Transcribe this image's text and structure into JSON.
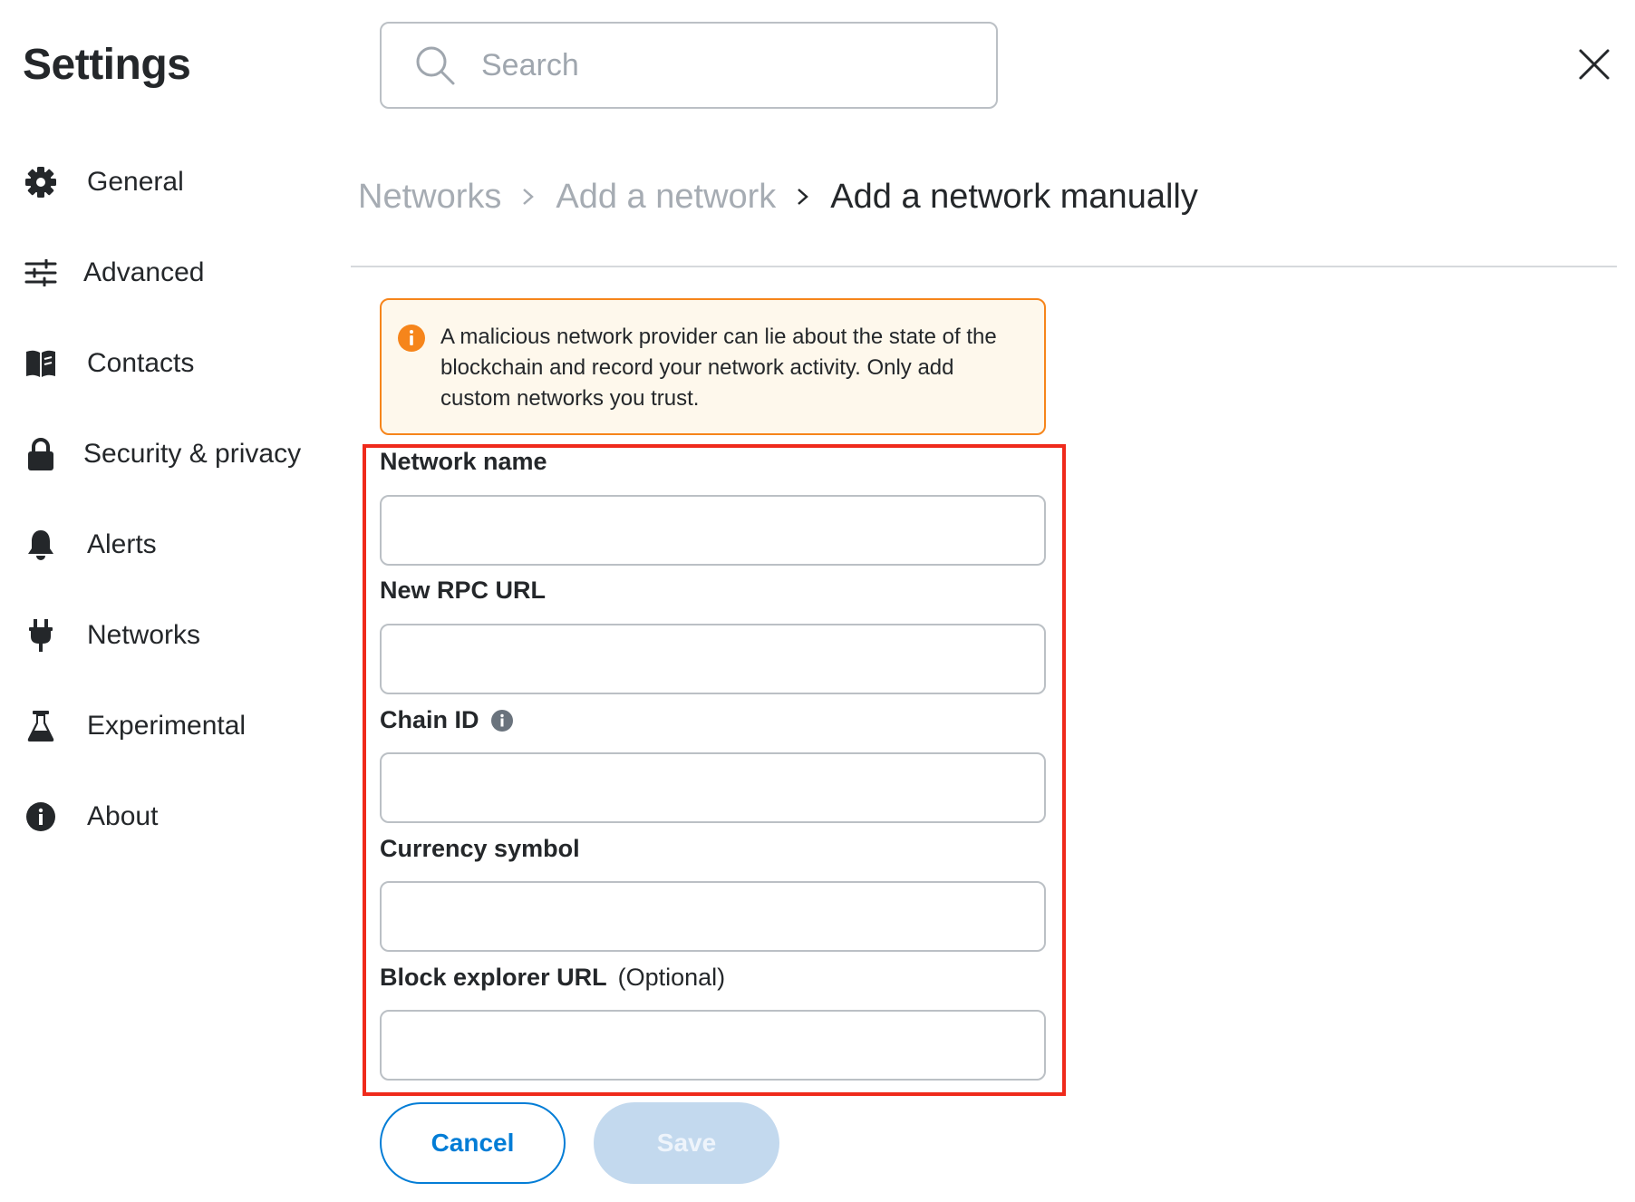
{
  "app": {
    "title": "Settings"
  },
  "search": {
    "placeholder": "Search"
  },
  "sidebar": {
    "items": [
      {
        "label": "General",
        "icon": "gear-icon"
      },
      {
        "label": "Advanced",
        "icon": "sliders-icon"
      },
      {
        "label": "Contacts",
        "icon": "book-icon"
      },
      {
        "label": "Security & privacy",
        "icon": "lock-icon"
      },
      {
        "label": "Alerts",
        "icon": "bell-icon"
      },
      {
        "label": "Networks",
        "icon": "plug-icon"
      },
      {
        "label": "Experimental",
        "icon": "flask-icon"
      },
      {
        "label": "About",
        "icon": "info-icon"
      }
    ]
  },
  "breadcrumb": {
    "items": [
      "Networks",
      "Add a network"
    ],
    "current": "Add a network manually"
  },
  "warning": {
    "text": "A malicious network provider can lie about the state of the blockchain and record your network activity. Only add custom networks you trust.",
    "color": "#f6851b"
  },
  "form": {
    "fields": [
      {
        "label": "Network name",
        "value": ""
      },
      {
        "label": "New RPC URL",
        "value": ""
      },
      {
        "label": "Chain ID",
        "value": ""
      },
      {
        "label": "Currency symbol",
        "value": ""
      },
      {
        "label": "Block explorer URL",
        "optional": "(Optional)",
        "value": ""
      }
    ]
  },
  "buttons": {
    "cancel": "Cancel",
    "save": "Save"
  },
  "colors": {
    "accent": "#037dd6",
    "highlight": "#ef2a1b",
    "warning": "#f6851b"
  }
}
